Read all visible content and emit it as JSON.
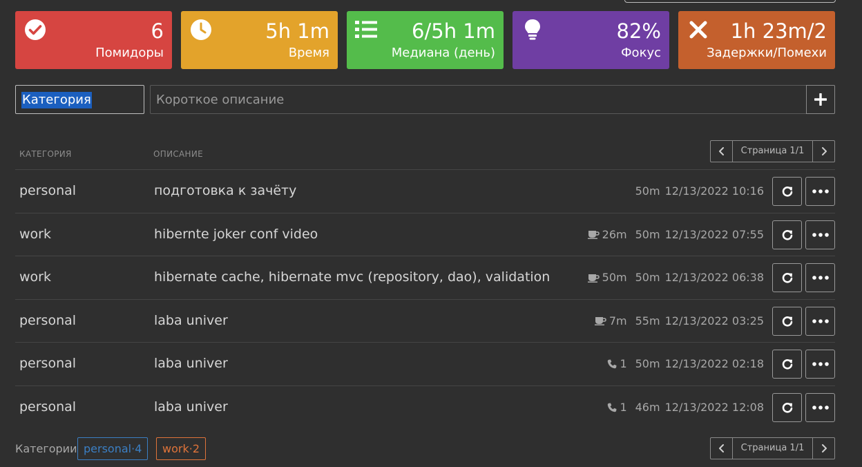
{
  "colors": {
    "pomodoros": "#d64541",
    "time": "#e3a32b",
    "median": "#54bc4b",
    "focus": "#6f3ea3",
    "interruptions": "#c4602d"
  },
  "stats": [
    {
      "icon": "check-circle-icon",
      "value": "6",
      "label": "Помидоры"
    },
    {
      "icon": "clock-icon",
      "value": "5h 1m",
      "label": "Время"
    },
    {
      "icon": "list-icon",
      "value": "6/5h 1m",
      "label": "Медиана (день)"
    },
    {
      "icon": "lightbulb-icon",
      "value": "82%",
      "label": "Фокус"
    },
    {
      "icon": "close-icon",
      "value": "1h 23m/2",
      "label": "Задержки/Помехи"
    }
  ],
  "form": {
    "category_value": "Категория",
    "description_placeholder": "Короткое описание"
  },
  "table": {
    "headers": {
      "category": "КАТЕГОРИЯ",
      "description": "ОПИСАНИЕ"
    },
    "page_label": "Страница 1/1",
    "rows": [
      {
        "category": "personal",
        "description": "подготовка к зачёту",
        "extra_icon": "",
        "extra": "",
        "duration": "50m",
        "date": "12/13/2022 10:16"
      },
      {
        "category": "work",
        "description": "hibernte joker conf video",
        "extra_icon": "coffee-icon",
        "extra": "26m",
        "duration": "50m",
        "date": "12/13/2022 07:55"
      },
      {
        "category": "work",
        "description": "hibernate cache, hibernate mvc (repository, dao), validation",
        "extra_icon": "coffee-icon",
        "extra": "50m",
        "duration": "50m",
        "date": "12/13/2022 06:38"
      },
      {
        "category": "personal",
        "description": "laba univer",
        "extra_icon": "coffee-icon",
        "extra": "7m",
        "duration": "55m",
        "date": "12/13/2022 03:25"
      },
      {
        "category": "personal",
        "description": "laba univer",
        "extra_icon": "phone-icon",
        "extra": "1",
        "duration": "50m",
        "date": "12/13/2022 02:18"
      },
      {
        "category": "personal",
        "description": "laba univer",
        "extra_icon": "phone-icon",
        "extra": "1",
        "duration": "46m",
        "date": "12/13/2022 12:08"
      }
    ]
  },
  "footer": {
    "categories_label": "Категории",
    "badges": [
      {
        "name": "personal",
        "count": "4"
      },
      {
        "name": "work",
        "count": "2"
      }
    ],
    "page_label": "Страница 1/1"
  }
}
